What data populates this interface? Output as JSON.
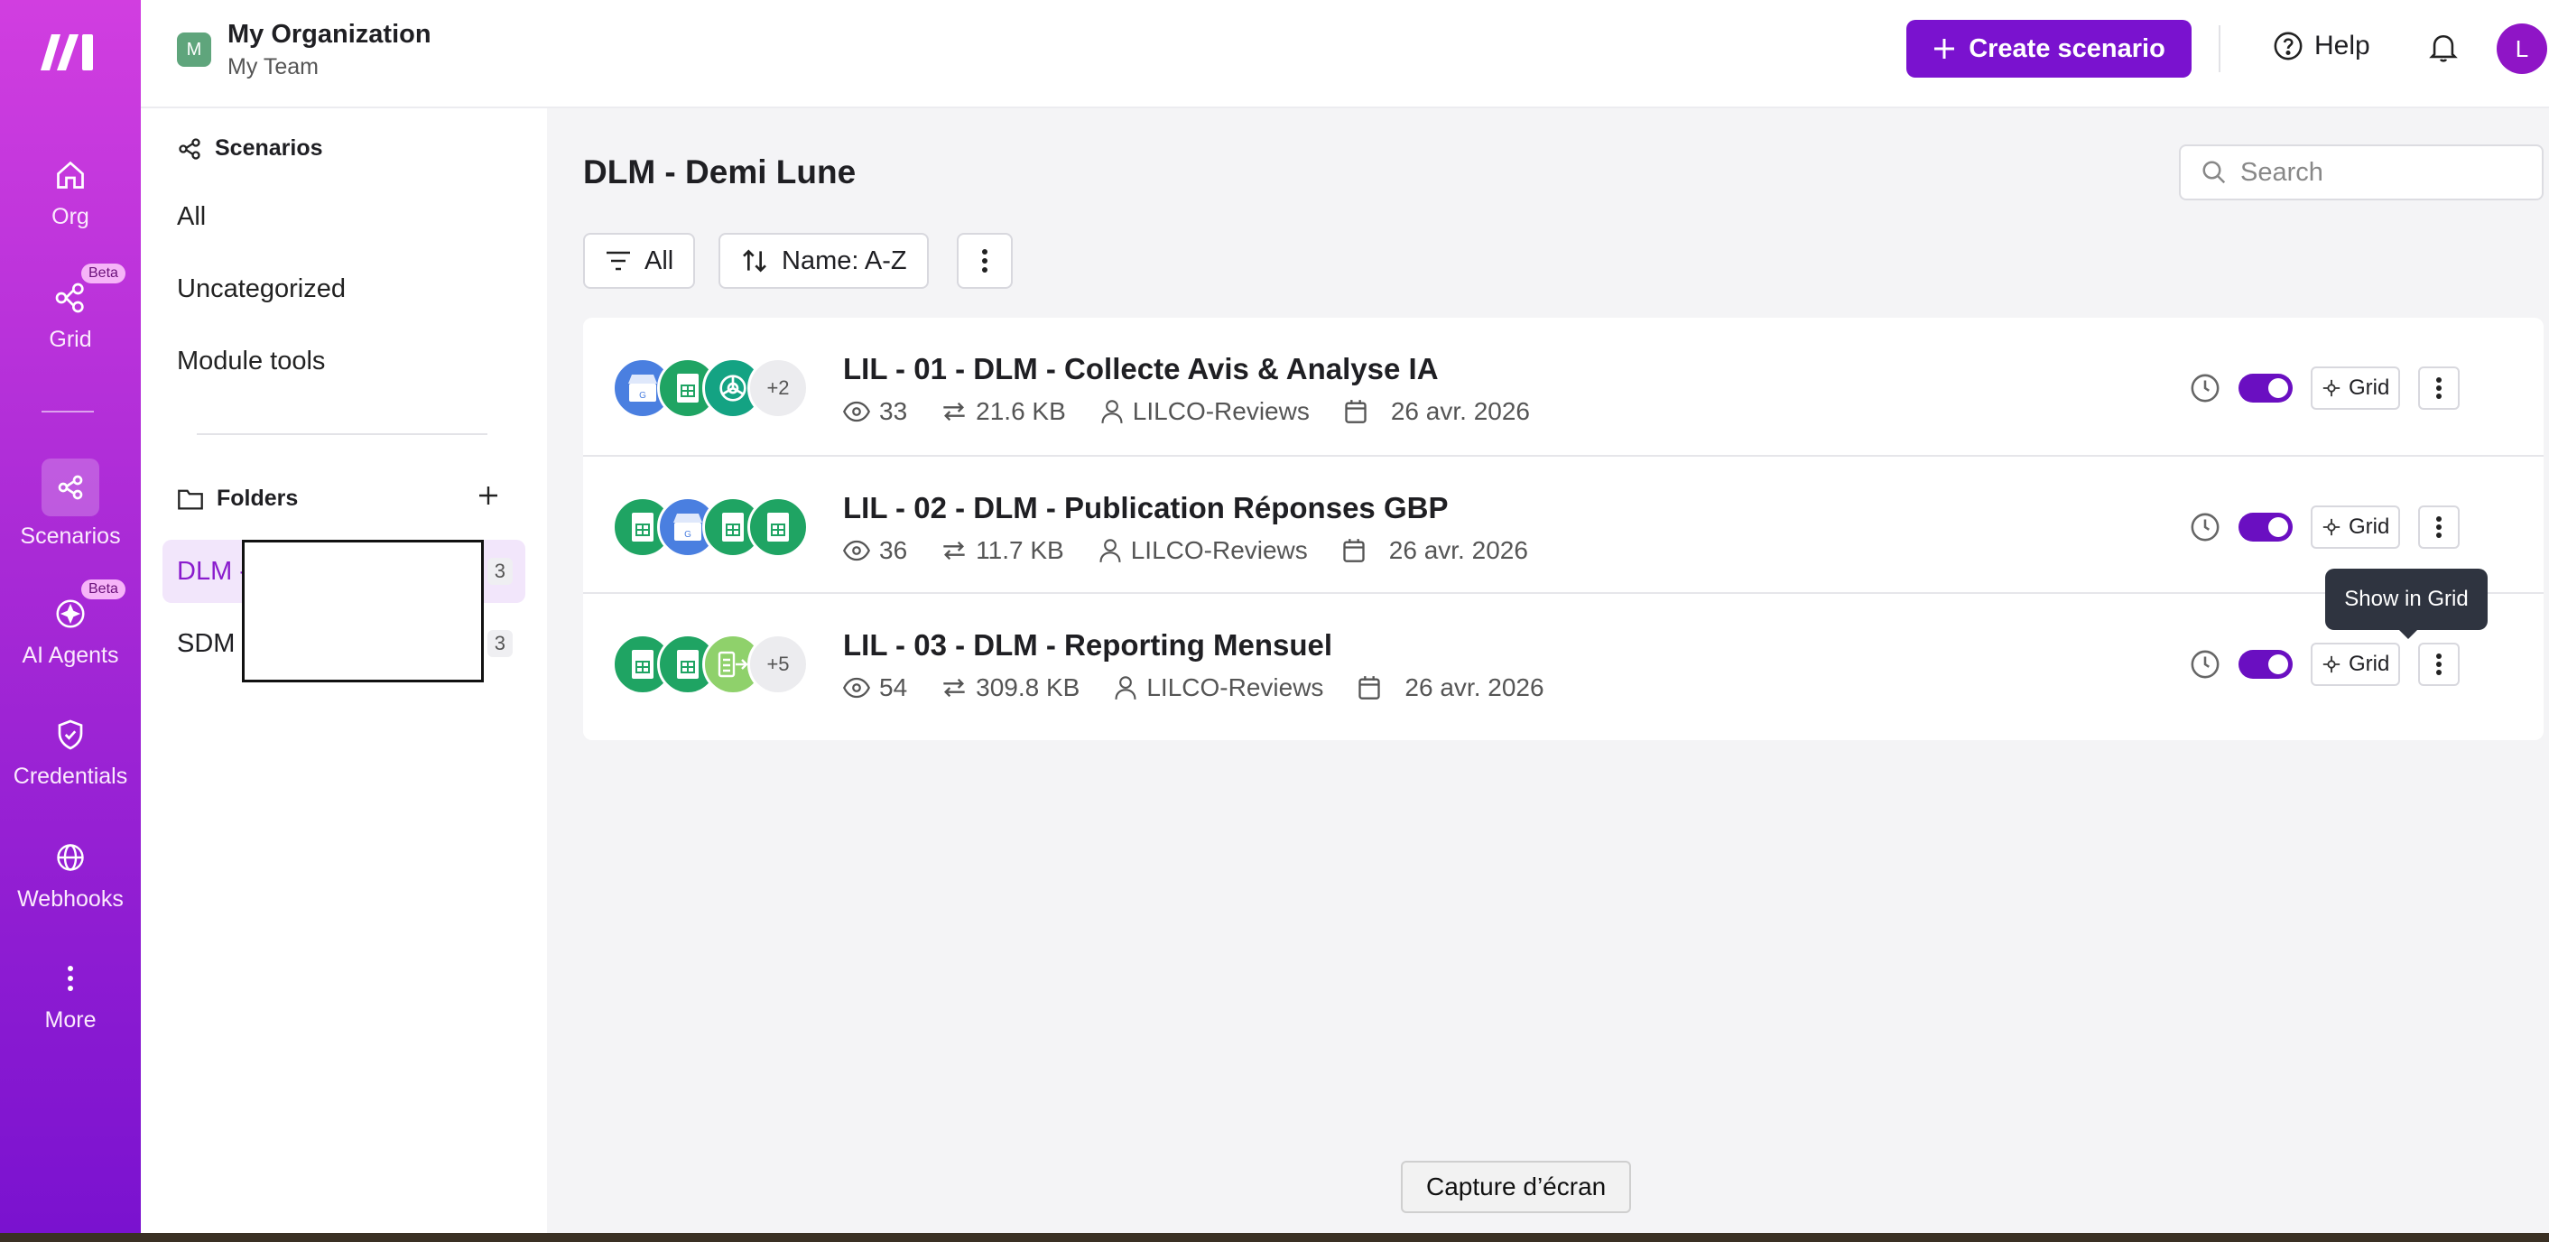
{
  "rail": {
    "items": [
      {
        "label": "Org",
        "icon": "home-icon"
      },
      {
        "label": "Grid",
        "icon": "grid-icon",
        "badge": "Beta"
      },
      {
        "label": "Scenarios",
        "icon": "share-icon",
        "active": true
      },
      {
        "label": "AI Agents",
        "icon": "ai-agent-icon",
        "badge": "Beta"
      },
      {
        "label": "Credentials",
        "icon": "shield-check-icon"
      },
      {
        "label": "Webhooks",
        "icon": "globe-icon"
      },
      {
        "label": "More",
        "icon": "more-vertical-icon"
      }
    ]
  },
  "header": {
    "org_initial": "M",
    "org_name": "My Organization",
    "team_name": "My Team",
    "create_label": "Create scenario",
    "help_label": "Help",
    "user_initial": "L"
  },
  "sidebar": {
    "title": "Scenarios",
    "links": [
      "All",
      "Uncategorized",
      "Module tools"
    ],
    "folders_title": "Folders",
    "folders": [
      {
        "name": "DLM -",
        "count": "3",
        "active": true
      },
      {
        "name": "SDM",
        "count": "3"
      }
    ]
  },
  "main": {
    "title": "DLM - Demi Lune",
    "search_placeholder": "Search",
    "filter_label": "All",
    "sort_label": "Name: A-Z",
    "grid_label": "Grid",
    "tooltip": "Show in Grid",
    "scenarios": [
      {
        "title": "LIL - 01 - DLM - Collecte Avis & Analyse IA",
        "views": "33",
        "size": "21.6 KB",
        "owner": "LILCO-Reviews",
        "date": "26 avr. 2026",
        "apps": [
          "google-business-icon",
          "google-sheets-icon",
          "openai-icon"
        ],
        "more": "+2"
      },
      {
        "title": "LIL - 02 - DLM - Publication Réponses GBP",
        "views": "36",
        "size": "11.7 KB",
        "owner": "LILCO-Reviews",
        "date": "26 avr. 2026",
        "apps": [
          "google-sheets-icon",
          "google-business-icon",
          "google-sheets-icon",
          "google-sheets-icon"
        ],
        "more": ""
      },
      {
        "title": "LIL - 03 - DLM - Reporting Mensuel",
        "views": "54",
        "size": "309.8 KB",
        "owner": "LILCO-Reviews",
        "date": "26 avr. 2026",
        "apps": [
          "google-sheets-icon",
          "google-sheets-icon",
          "sheet-export-icon"
        ],
        "more": "+5"
      }
    ]
  },
  "os_tooltip": "Capture d’écran",
  "colors": {
    "brand": "#7a12cf",
    "sheets": "#1fa463",
    "business": "#4a7fe0",
    "openai": "#14a383"
  }
}
